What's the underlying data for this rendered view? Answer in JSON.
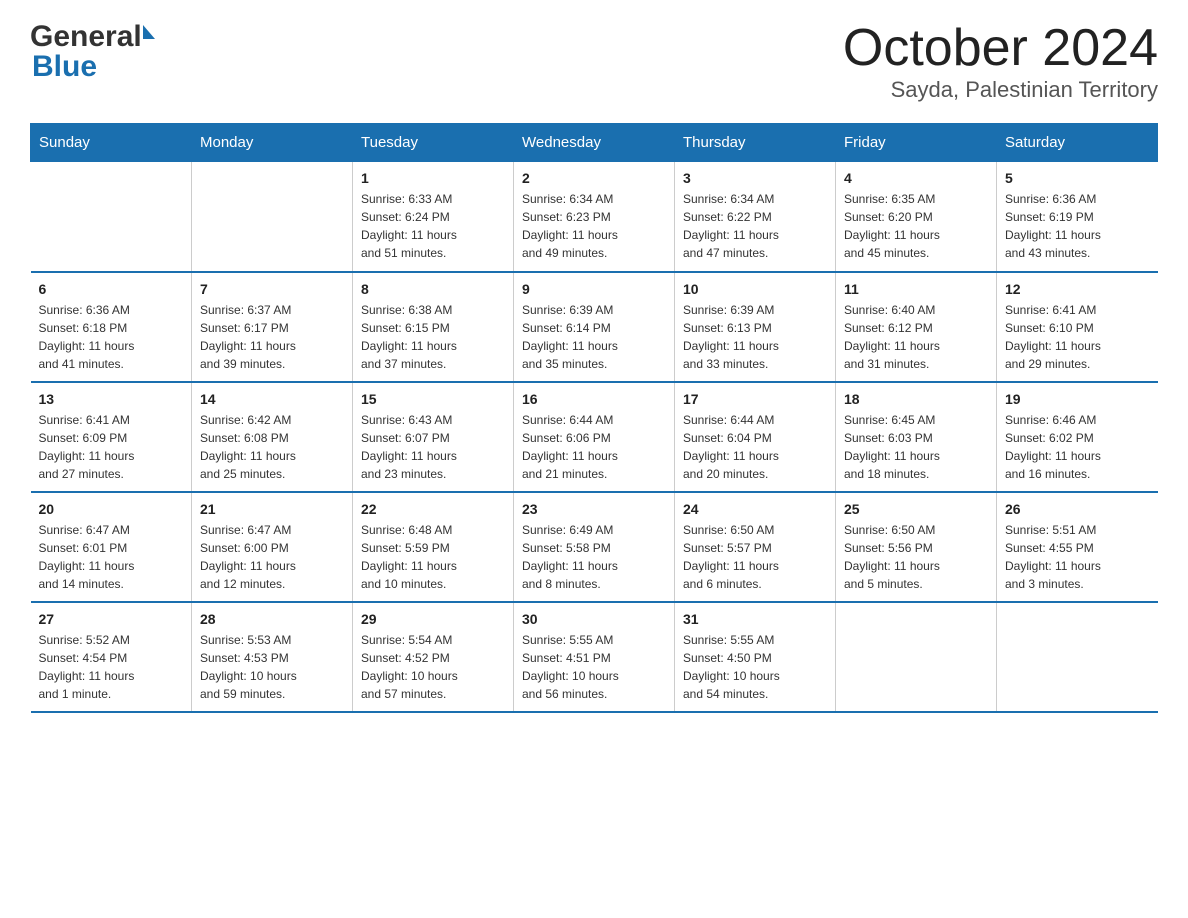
{
  "header": {
    "month": "October 2024",
    "location": "Sayda, Palestinian Territory"
  },
  "days_of_week": [
    "Sunday",
    "Monday",
    "Tuesday",
    "Wednesday",
    "Thursday",
    "Friday",
    "Saturday"
  ],
  "weeks": [
    [
      {
        "day": "",
        "info": ""
      },
      {
        "day": "",
        "info": ""
      },
      {
        "day": "1",
        "info": "Sunrise: 6:33 AM\nSunset: 6:24 PM\nDaylight: 11 hours\nand 51 minutes."
      },
      {
        "day": "2",
        "info": "Sunrise: 6:34 AM\nSunset: 6:23 PM\nDaylight: 11 hours\nand 49 minutes."
      },
      {
        "day": "3",
        "info": "Sunrise: 6:34 AM\nSunset: 6:22 PM\nDaylight: 11 hours\nand 47 minutes."
      },
      {
        "day": "4",
        "info": "Sunrise: 6:35 AM\nSunset: 6:20 PM\nDaylight: 11 hours\nand 45 minutes."
      },
      {
        "day": "5",
        "info": "Sunrise: 6:36 AM\nSunset: 6:19 PM\nDaylight: 11 hours\nand 43 minutes."
      }
    ],
    [
      {
        "day": "6",
        "info": "Sunrise: 6:36 AM\nSunset: 6:18 PM\nDaylight: 11 hours\nand 41 minutes."
      },
      {
        "day": "7",
        "info": "Sunrise: 6:37 AM\nSunset: 6:17 PM\nDaylight: 11 hours\nand 39 minutes."
      },
      {
        "day": "8",
        "info": "Sunrise: 6:38 AM\nSunset: 6:15 PM\nDaylight: 11 hours\nand 37 minutes."
      },
      {
        "day": "9",
        "info": "Sunrise: 6:39 AM\nSunset: 6:14 PM\nDaylight: 11 hours\nand 35 minutes."
      },
      {
        "day": "10",
        "info": "Sunrise: 6:39 AM\nSunset: 6:13 PM\nDaylight: 11 hours\nand 33 minutes."
      },
      {
        "day": "11",
        "info": "Sunrise: 6:40 AM\nSunset: 6:12 PM\nDaylight: 11 hours\nand 31 minutes."
      },
      {
        "day": "12",
        "info": "Sunrise: 6:41 AM\nSunset: 6:10 PM\nDaylight: 11 hours\nand 29 minutes."
      }
    ],
    [
      {
        "day": "13",
        "info": "Sunrise: 6:41 AM\nSunset: 6:09 PM\nDaylight: 11 hours\nand 27 minutes."
      },
      {
        "day": "14",
        "info": "Sunrise: 6:42 AM\nSunset: 6:08 PM\nDaylight: 11 hours\nand 25 minutes."
      },
      {
        "day": "15",
        "info": "Sunrise: 6:43 AM\nSunset: 6:07 PM\nDaylight: 11 hours\nand 23 minutes."
      },
      {
        "day": "16",
        "info": "Sunrise: 6:44 AM\nSunset: 6:06 PM\nDaylight: 11 hours\nand 21 minutes."
      },
      {
        "day": "17",
        "info": "Sunrise: 6:44 AM\nSunset: 6:04 PM\nDaylight: 11 hours\nand 20 minutes."
      },
      {
        "day": "18",
        "info": "Sunrise: 6:45 AM\nSunset: 6:03 PM\nDaylight: 11 hours\nand 18 minutes."
      },
      {
        "day": "19",
        "info": "Sunrise: 6:46 AM\nSunset: 6:02 PM\nDaylight: 11 hours\nand 16 minutes."
      }
    ],
    [
      {
        "day": "20",
        "info": "Sunrise: 6:47 AM\nSunset: 6:01 PM\nDaylight: 11 hours\nand 14 minutes."
      },
      {
        "day": "21",
        "info": "Sunrise: 6:47 AM\nSunset: 6:00 PM\nDaylight: 11 hours\nand 12 minutes."
      },
      {
        "day": "22",
        "info": "Sunrise: 6:48 AM\nSunset: 5:59 PM\nDaylight: 11 hours\nand 10 minutes."
      },
      {
        "day": "23",
        "info": "Sunrise: 6:49 AM\nSunset: 5:58 PM\nDaylight: 11 hours\nand 8 minutes."
      },
      {
        "day": "24",
        "info": "Sunrise: 6:50 AM\nSunset: 5:57 PM\nDaylight: 11 hours\nand 6 minutes."
      },
      {
        "day": "25",
        "info": "Sunrise: 6:50 AM\nSunset: 5:56 PM\nDaylight: 11 hours\nand 5 minutes."
      },
      {
        "day": "26",
        "info": "Sunrise: 5:51 AM\nSunset: 4:55 PM\nDaylight: 11 hours\nand 3 minutes."
      }
    ],
    [
      {
        "day": "27",
        "info": "Sunrise: 5:52 AM\nSunset: 4:54 PM\nDaylight: 11 hours\nand 1 minute."
      },
      {
        "day": "28",
        "info": "Sunrise: 5:53 AM\nSunset: 4:53 PM\nDaylight: 10 hours\nand 59 minutes."
      },
      {
        "day": "29",
        "info": "Sunrise: 5:54 AM\nSunset: 4:52 PM\nDaylight: 10 hours\nand 57 minutes."
      },
      {
        "day": "30",
        "info": "Sunrise: 5:55 AM\nSunset: 4:51 PM\nDaylight: 10 hours\nand 56 minutes."
      },
      {
        "day": "31",
        "info": "Sunrise: 5:55 AM\nSunset: 4:50 PM\nDaylight: 10 hours\nand 54 minutes."
      },
      {
        "day": "",
        "info": ""
      },
      {
        "day": "",
        "info": ""
      }
    ]
  ]
}
